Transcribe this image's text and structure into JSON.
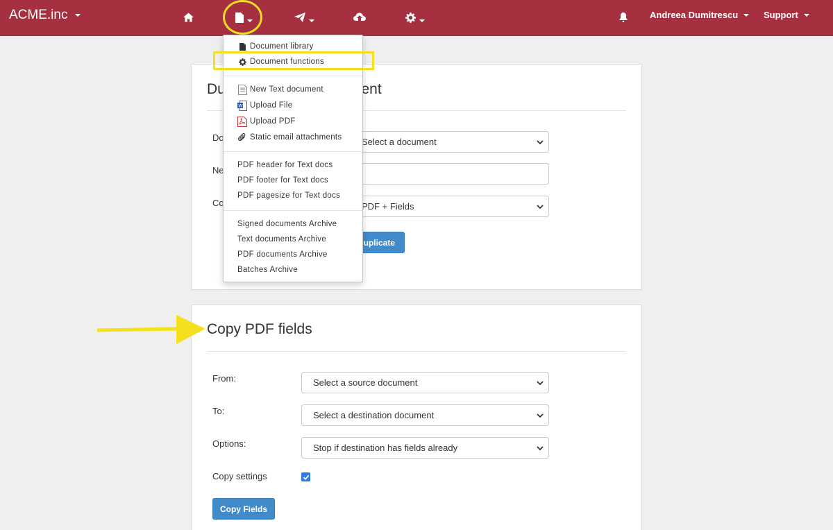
{
  "navbar": {
    "brand": "ACME.inc",
    "user": "Andreea Dumitrescu",
    "support": "Support",
    "bg_color": "#a63040",
    "icons": [
      "home-icon",
      "document-icon",
      "send-icon",
      "cloud-upload-icon",
      "gear-icon",
      "bell-icon"
    ]
  },
  "menu": {
    "items": [
      {
        "label": "Document library",
        "icon": "document-icon"
      },
      {
        "label": "Document functions",
        "icon": "gear-icon"
      },
      {
        "label": "New Text document",
        "icon": "text-doc-icon"
      },
      {
        "label": "Upload File",
        "icon": "word-doc-icon"
      },
      {
        "label": "Upload PDF",
        "icon": "pdf-doc-icon"
      },
      {
        "label": "Static email attachments",
        "icon": "paperclip-icon"
      },
      {
        "label": "PDF header for Text docs"
      },
      {
        "label": "PDF footer for Text docs"
      },
      {
        "label": "PDF pagesize for Text docs"
      },
      {
        "label": "Signed documents Archive"
      },
      {
        "label": "Text documents Archive"
      },
      {
        "label": "PDF documents Archive"
      },
      {
        "label": "Batches Archive"
      }
    ]
  },
  "duplicate_panel": {
    "title_start": "Du",
    "title_end": "ment",
    "label_doc": "Do",
    "label_new": "Ne",
    "label_copy": "Co",
    "doc_select": "Select a document",
    "copy_select": "PDF + Fields",
    "button": "uplicate"
  },
  "copy_panel": {
    "title": "Copy PDF fields",
    "from_label": "From:",
    "from_select": "Select a source document",
    "to_label": "To:",
    "to_select": "Select a destination document",
    "options_label": "Options:",
    "options_select": "Stop if destination has fields already",
    "settings_label": "Copy settings",
    "settings_checked": true,
    "button": "Copy Fields"
  },
  "annotation_color": "#f5e020"
}
